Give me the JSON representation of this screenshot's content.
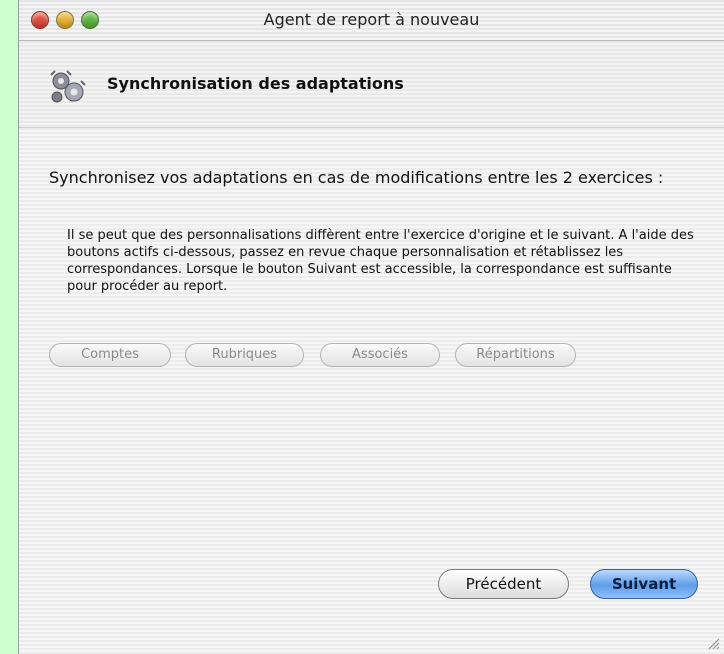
{
  "window": {
    "title": "Agent de report à nouveau"
  },
  "header": {
    "title": "Synchronisation des adaptations",
    "icon": "gears-icon"
  },
  "content": {
    "intro": "Synchronisez vos adaptations en cas de modifications entre les 2 exercices :",
    "detail": "Il se peut que des personnalisations diffèrent entre l'exercice d'origine et le suivant. A l'aide des boutons actifs ci-dessous, passez en revue chaque personnalisation et rétablissez les correspondances. Lorsque le bouton Suivant est accessible, la correspondance est suffisante pour procéder au report."
  },
  "sections": {
    "comptes": "Comptes",
    "rubriques": "Rubriques",
    "associes": "Associés",
    "repartitions": "Répartitions"
  },
  "navigation": {
    "previous": "Précédent",
    "next": "Suivant"
  },
  "colors": {
    "desktop": "#ccffcc",
    "close": "#e3493c",
    "minimize": "#e9b22f",
    "zoom": "#5cb63b",
    "default_button": "#5f9de8"
  }
}
